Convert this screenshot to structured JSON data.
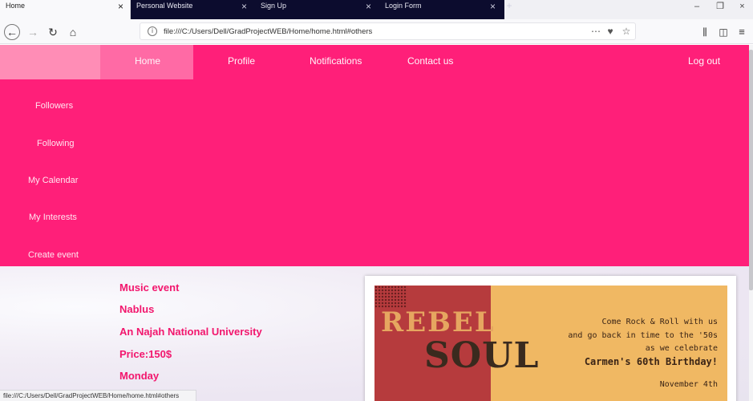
{
  "browser": {
    "tabs": [
      {
        "label": "Home",
        "active": true
      },
      {
        "label": "Personal Website"
      },
      {
        "label": "Sign Up"
      },
      {
        "label": "Login Form"
      }
    ],
    "new_tab_icon": "plus-icon",
    "url": "file:///C:/Users/Dell/GradProjectWEB/Home/home.html#others",
    "status_url": "file:///C:/Users/Dell/GradProjectWEB/Home/home.html#others",
    "window_controls": [
      "minimize-icon",
      "restore-icon",
      "close-icon"
    ]
  },
  "site": {
    "top_nav": [
      "Home",
      "Profile",
      "Notifications",
      "Contact us"
    ],
    "logout": "Log out",
    "sidebar": [
      "Followers",
      "Following",
      "My Calendar",
      "My Interests",
      "Create event"
    ],
    "event": {
      "type": "Music event",
      "city": "Nablus",
      "venue": "An Najah National University",
      "price": "Price:150$",
      "day": "Monday"
    },
    "poster": {
      "title_line1": "REBEL",
      "title_line2": "SOUL",
      "text_lines": [
        "Come Rock & Roll with us",
        "and go back in time to the '50s",
        "as we celebrate"
      ],
      "headline": "Carmen's 60th Birthday!",
      "date_fragment": "November 4th"
    }
  },
  "colors": {
    "nav_pink": "#ff1f79",
    "active_pink": "#ff6aa5",
    "event_text": "#f2166d",
    "poster_gold": "#f0b863",
    "poster_red": "#b63b3d"
  }
}
